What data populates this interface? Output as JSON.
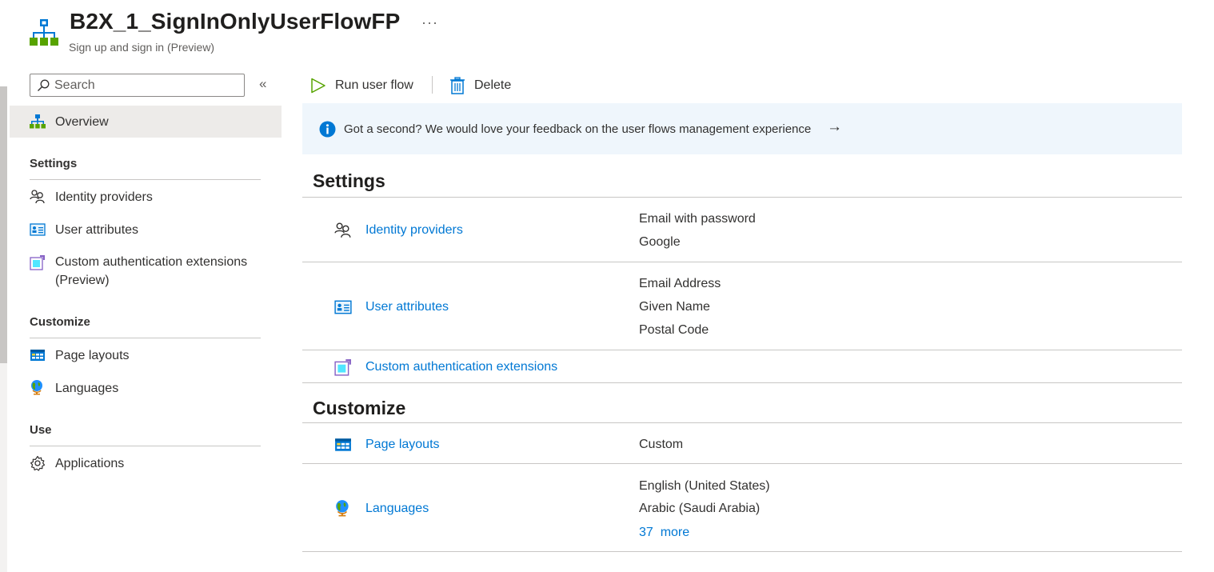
{
  "header": {
    "title": "B2X_1_SignInOnlyUserFlowFP",
    "subtitle": "Sign up and sign in (Preview)",
    "more_label": "···"
  },
  "sidebar": {
    "search_placeholder": "Search",
    "collapse_label": "«",
    "overview_label": "Overview",
    "sections": {
      "settings": "Settings",
      "customize": "Customize",
      "use": "Use"
    },
    "items": {
      "identity_providers": "Identity providers",
      "user_attributes": "User attributes",
      "custom_auth_line1": "Custom authentication extensions",
      "custom_auth_line2": "(Preview)",
      "page_layouts": "Page layouts",
      "languages": "Languages",
      "applications": "Applications"
    }
  },
  "toolbar": {
    "run_label": "Run user flow",
    "delete_label": "Delete"
  },
  "banner": {
    "text": "Got a second? We would love your feedback on the user flows management experience",
    "arrow": "→"
  },
  "main": {
    "settings_title": "Settings",
    "customize_title": "Customize",
    "identity_providers": {
      "label": "Identity providers",
      "values": [
        "Email with password",
        "Google"
      ]
    },
    "user_attributes": {
      "label": "User attributes",
      "values": [
        "Email Address",
        "Given Name",
        "Postal Code"
      ]
    },
    "custom_auth": {
      "label": "Custom authentication extensions"
    },
    "page_layouts": {
      "label": "Page layouts",
      "values": [
        "Custom"
      ]
    },
    "languages": {
      "label": "Languages",
      "values": [
        "English (United States)",
        "Arabic (Saudi Arabia)"
      ],
      "more": "37  more"
    }
  },
  "colors": {
    "link": "#0078d4",
    "banner_bg": "#eff6fc",
    "selected_bg": "#edebe9",
    "run_icon": "#57a300"
  },
  "icons": {
    "header": "user-flow-icon",
    "search": "search-icon",
    "info": "info-icon",
    "run": "play-icon",
    "delete": "trash-icon"
  }
}
